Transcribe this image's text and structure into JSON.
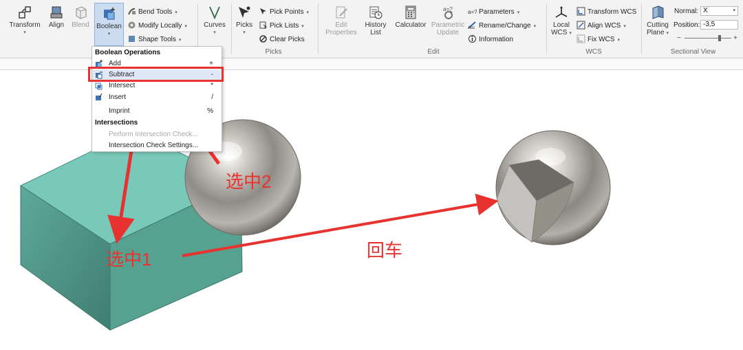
{
  "ribbon": {
    "transform": "Transform",
    "align": "Align",
    "blend": "Blend",
    "boolean": "Boolean",
    "bend_tools": "Bend Tools",
    "modify_locally": "Modify Locally",
    "shape_tools": "Shape Tools",
    "curves": "Curves",
    "picks": "Picks",
    "pick_points": "Pick Points",
    "pick_lists": "Pick Lists",
    "clear_picks": "Clear Picks",
    "group_picks": "Picks",
    "edit_properties_1": "Edit",
    "edit_properties_2": "Properties",
    "history_1": "History",
    "history_2": "List",
    "calculator": "Calculator",
    "parametric_1": "Parametric",
    "parametric_2": "Update",
    "parameters": "Parameters",
    "rename_change": "Rename/Change",
    "information": "Information",
    "group_edit": "Edit",
    "local_wcs_1": "Local",
    "local_wcs_2": "WCS",
    "transform_wcs": "Transform WCS",
    "align_wcs": "Align WCS",
    "fix_wcs": "Fix WCS",
    "group_wcs": "WCS",
    "cutting_1": "Cutting",
    "cutting_2": "Plane",
    "normal_label": "Normal:",
    "normal_value": "X",
    "position_label": "Position:",
    "position_value": "-3,5",
    "group_sectional": "Sectional View",
    "slider_minus": "−",
    "slider_plus": "+"
  },
  "menu": {
    "header1": "Boolean Operations",
    "add": "Add",
    "add_key": "+",
    "subtract": "Subtract",
    "subtract_key": "-",
    "intersect": "Intersect",
    "intersect_key": "*",
    "insert": "Insert",
    "insert_key": "/",
    "imprint": "Imprint",
    "imprint_key": "%",
    "header2": "Intersections",
    "perform": "Perform Intersection Check...",
    "settings": "Intersection Check Settings..."
  },
  "annotations": {
    "select1": "选中1",
    "select2": "选中2",
    "enter": "回车"
  },
  "colors": {
    "box": "#79c9ba",
    "annotation": "#e8322f",
    "highlight": "#dfe8f6"
  }
}
